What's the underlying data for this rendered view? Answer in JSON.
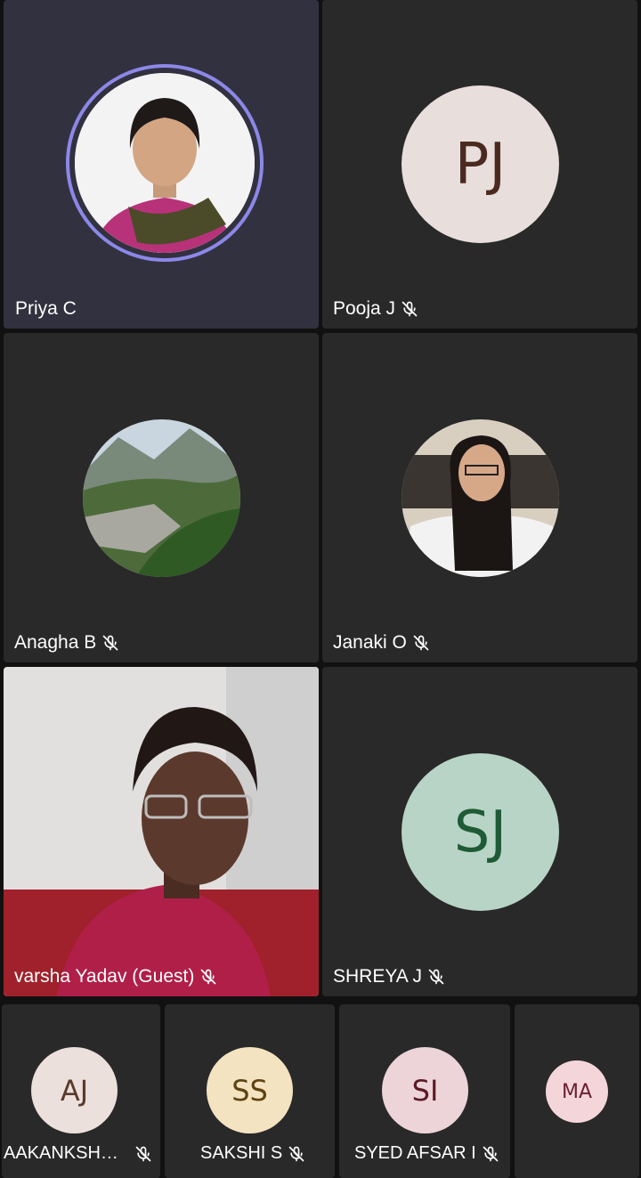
{
  "participants": {
    "priya": {
      "name": "Priya C"
    },
    "pooja": {
      "name": "Pooja J",
      "initials": "PJ",
      "avatar_bg": "#e8dedc",
      "initials_color": "#4a2a1f"
    },
    "anagha": {
      "name": "Anagha B"
    },
    "janaki": {
      "name": "Janaki O"
    },
    "varsha": {
      "name": "varsha Yadav (Guest)"
    },
    "shreya": {
      "name": "SHREYA J",
      "initials": "SJ",
      "avatar_bg": "#b8d4c6",
      "initials_color": "#1f5a36"
    },
    "aakanksha": {
      "name": "AAKANKSH…",
      "initials": "AJ",
      "avatar_bg": "#ece0dc",
      "initials_color": "#5a3a2c"
    },
    "sakshi": {
      "name": "SAKSHI S",
      "initials": "SS",
      "avatar_bg": "#f4e3c0",
      "initials_color": "#5c4312"
    },
    "syed": {
      "name": "SYED AFSAR I",
      "initials": "SI",
      "avatar_bg": "#ecd4d8",
      "initials_color": "#5a1a24"
    },
    "ma": {
      "initials": "MA",
      "avatar_bg": "#f4d6da",
      "initials_color": "#6a2030"
    }
  },
  "icons": {
    "mic_off": "mic-off-icon"
  },
  "colors": {
    "active_tile": "#32313f",
    "tile": "#292929",
    "speaking_ring": "#8c88e8"
  }
}
